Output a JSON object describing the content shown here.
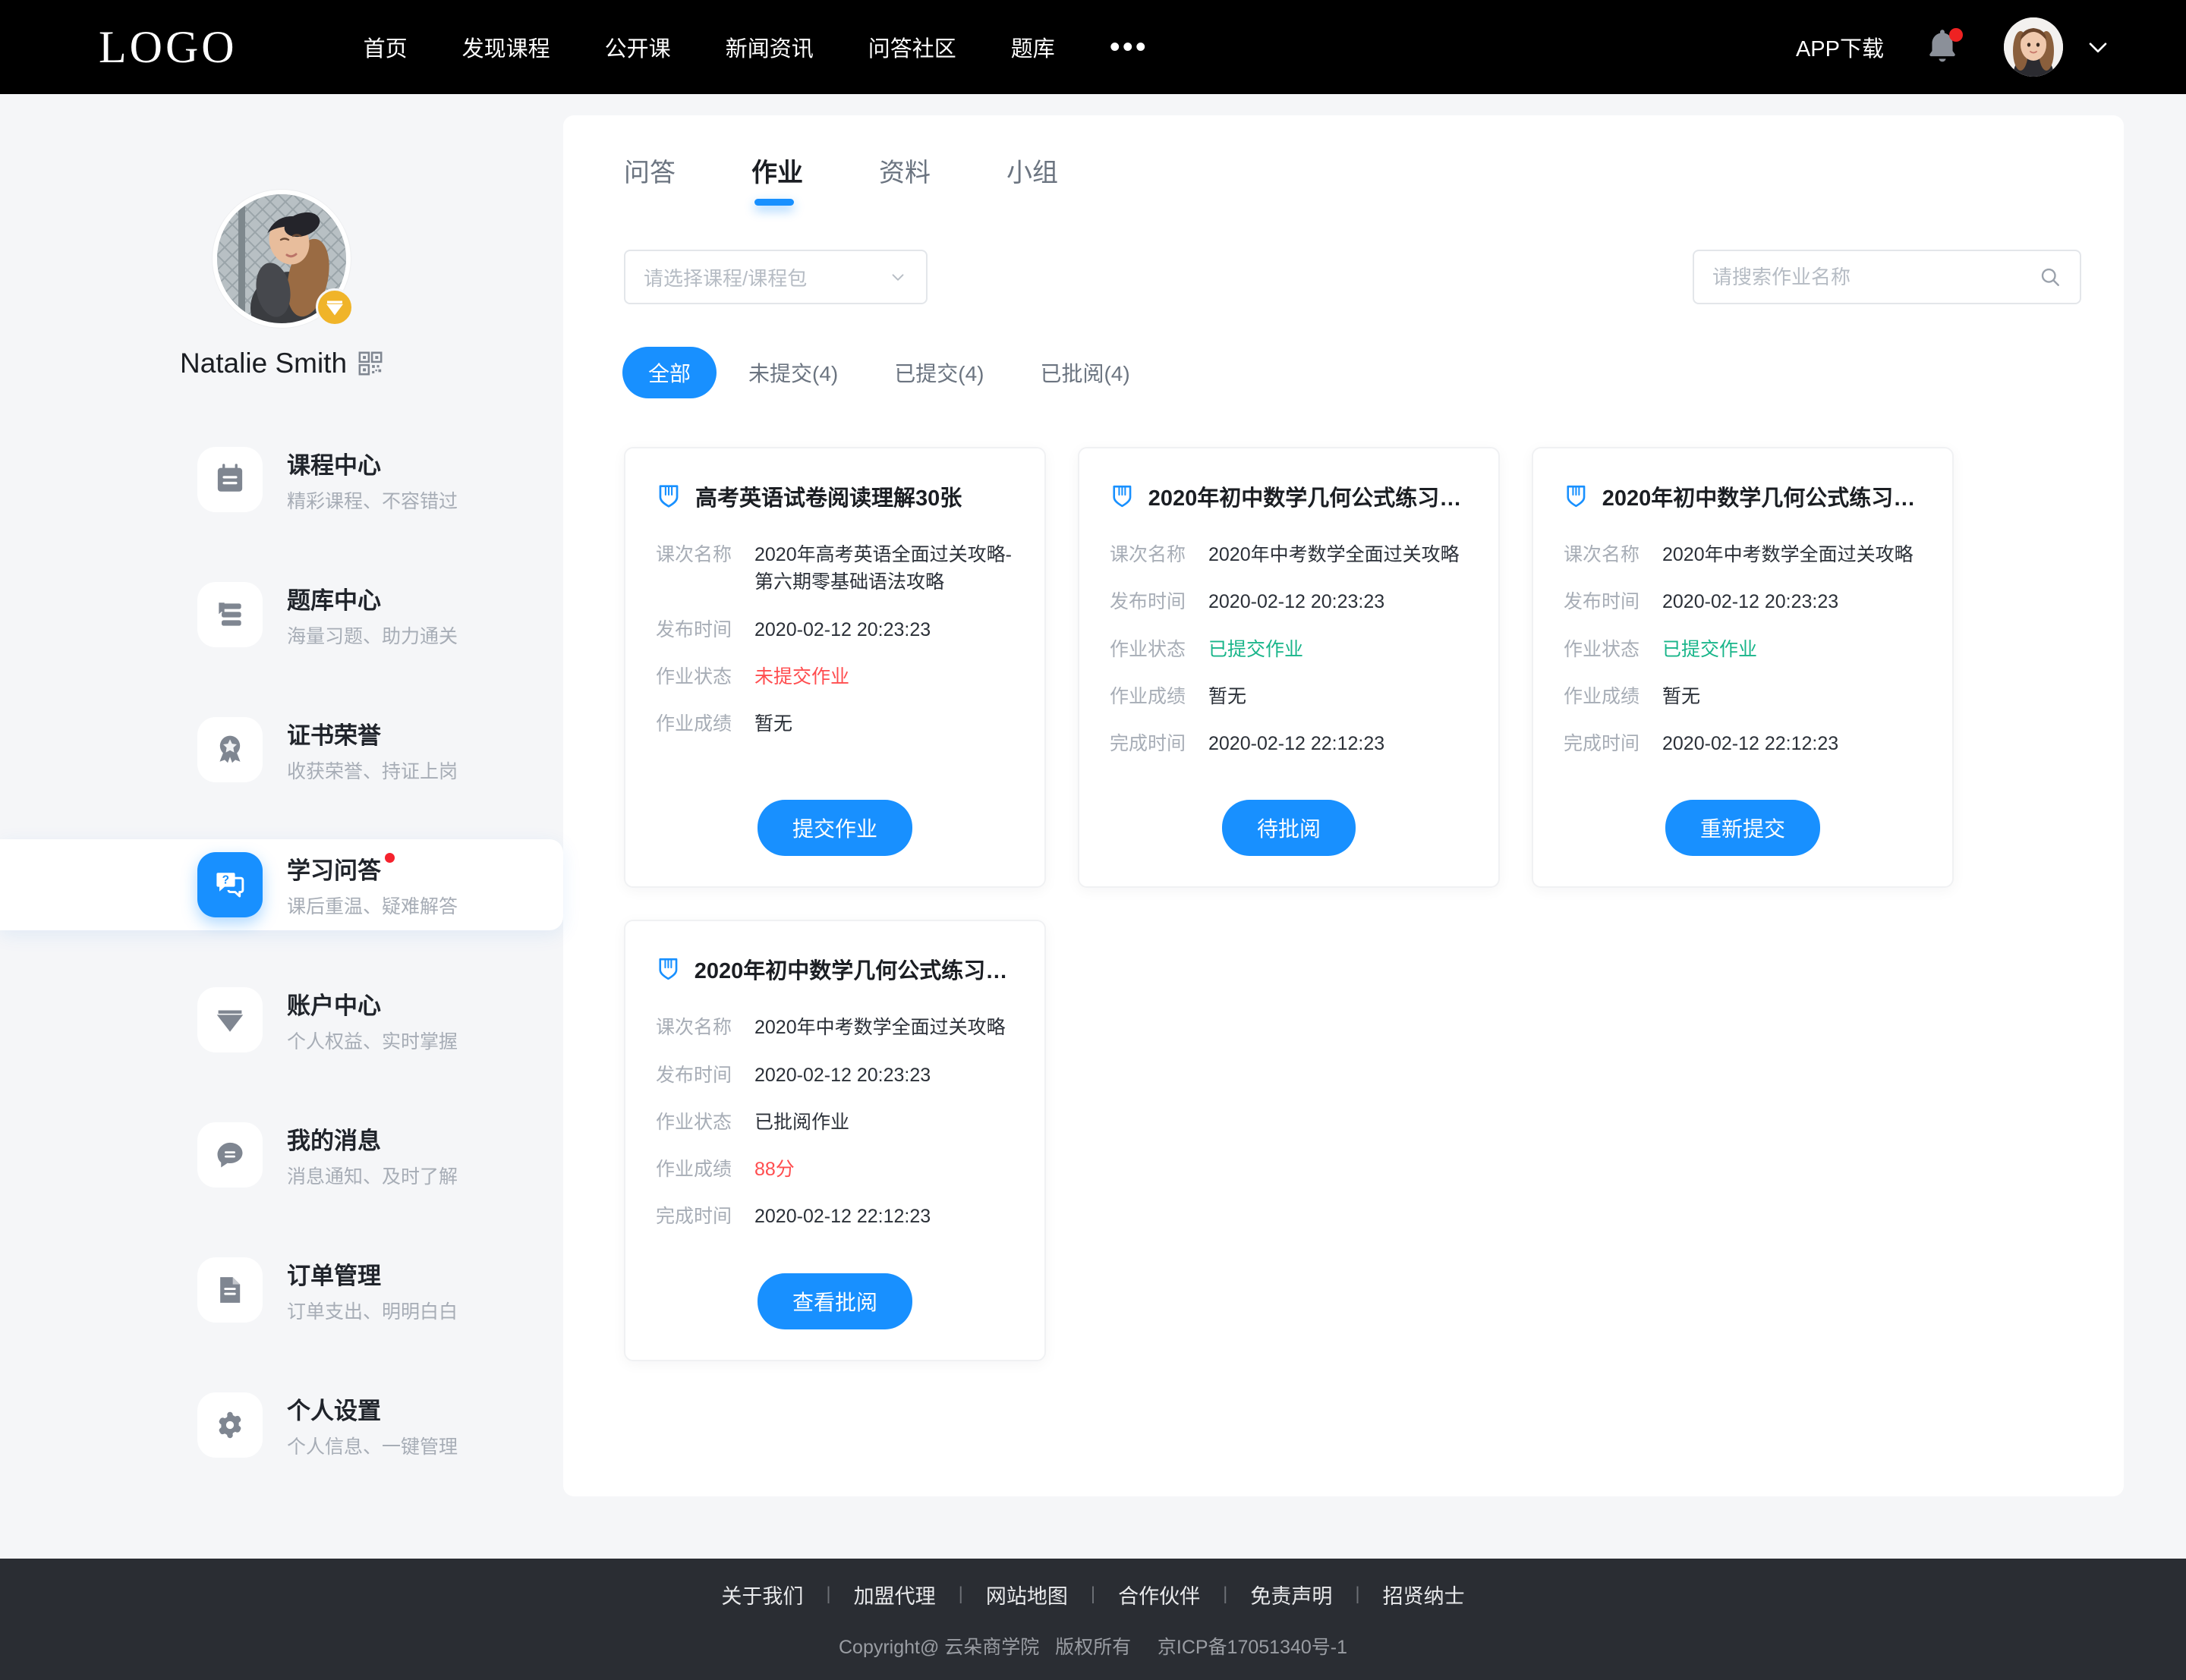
{
  "header": {
    "logo": "LOGO",
    "nav_items": [
      {
        "label": "首页"
      },
      {
        "label": "发现课程"
      },
      {
        "label": "公开课"
      },
      {
        "label": "新闻资讯"
      },
      {
        "label": "问答社区"
      },
      {
        "label": "题库"
      }
    ],
    "more_label": "•••",
    "app_download": "APP下载",
    "bell_icon": "bell-icon",
    "bell_has_badge": true,
    "avatar_icon": "user-avatar",
    "chevron_icon": "chevron-down-icon",
    "background": "#000000"
  },
  "sidebar": {
    "avatar_icon": "profile-avatar",
    "vip_badge_icon": "diamond-icon",
    "vip_badge_color": "#f0b429",
    "username": "Natalie Smith",
    "qr_icon": "qr-code-icon",
    "items": [
      {
        "title": "课程中心",
        "subtitle": "精彩课程、不容错过",
        "icon": "calendar-icon",
        "active": false,
        "dot": false
      },
      {
        "title": "题库中心",
        "subtitle": "海量习题、助力通关",
        "icon": "books-icon",
        "active": false,
        "dot": false
      },
      {
        "title": "证书荣誉",
        "subtitle": "收获荣誉、持证上岗",
        "icon": "medal-icon",
        "active": false,
        "dot": false
      },
      {
        "title": "学习问答",
        "subtitle": "课后重温、疑难解答",
        "icon": "question-chat-icon",
        "active": true,
        "dot": true
      },
      {
        "title": "账户中心",
        "subtitle": "个人权益、实时掌握",
        "icon": "diamond-icon",
        "active": false,
        "dot": false
      },
      {
        "title": "我的消息",
        "subtitle": "消息通知、及时了解",
        "icon": "message-icon",
        "active": false,
        "dot": false
      },
      {
        "title": "订单管理",
        "subtitle": "订单支出、明明白白",
        "icon": "document-icon",
        "active": false,
        "dot": false
      },
      {
        "title": "个人设置",
        "subtitle": "个人信息、一键管理",
        "icon": "gear-icon",
        "active": false,
        "dot": false
      }
    ]
  },
  "main": {
    "tabs": [
      {
        "label": "问答",
        "active": false
      },
      {
        "label": "作业",
        "active": true
      },
      {
        "label": "资料",
        "active": false
      },
      {
        "label": "小组",
        "active": false
      }
    ],
    "course_select": {
      "placeholder": "请选择课程/课程包",
      "value": "",
      "chevron_icon": "chevron-down-icon"
    },
    "search": {
      "placeholder": "请搜索作业名称",
      "value": "",
      "icon": "search-icon"
    },
    "filters": [
      {
        "label": "全部",
        "active": true
      },
      {
        "label": "未提交(4)",
        "active": false
      },
      {
        "label": "已提交(4)",
        "active": false
      },
      {
        "label": "已批阅(4)",
        "active": false
      }
    ],
    "field_labels": {
      "course": "课次名称",
      "publish": "发布时间",
      "status": "作业状态",
      "score": "作业成绩",
      "finish": "完成时间"
    },
    "cards": [
      {
        "icon": "homework-shield-icon",
        "title": "高考英语试卷阅读理解30张",
        "course": "2020年高考英语全面过关攻略-第六期零基础语法攻略",
        "publish": "2020-02-12 20:23:23",
        "status": "未提交作业",
        "status_color": "red",
        "score": "暂无",
        "score_color": "normal",
        "finish": "",
        "button": "提交作业"
      },
      {
        "icon": "homework-shield-icon",
        "title": "2020年初中数学几何公式练习作...",
        "course": "2020年中考数学全面过关攻略",
        "publish": "2020-02-12 20:23:23",
        "status": "已提交作业",
        "status_color": "green",
        "score": "暂无",
        "score_color": "normal",
        "finish": "2020-02-12 22:12:23",
        "button": "待批阅"
      },
      {
        "icon": "homework-shield-icon",
        "title": "2020年初中数学几何公式练习作...",
        "course": "2020年中考数学全面过关攻略",
        "publish": "2020-02-12 20:23:23",
        "status": "已提交作业",
        "status_color": "green",
        "score": "暂无",
        "score_color": "normal",
        "finish": "2020-02-12 22:12:23",
        "button": "重新提交"
      },
      {
        "icon": "homework-shield-icon",
        "title": "2020年初中数学几何公式练习作...",
        "course": "2020年中考数学全面过关攻略",
        "publish": "2020-02-12 20:23:23",
        "status": "已批阅作业",
        "status_color": "normal",
        "score": "88分",
        "score_color": "red",
        "finish": "2020-02-12 22:12:23",
        "button": "查看批阅"
      }
    ]
  },
  "footer": {
    "links": [
      {
        "label": "关于我们"
      },
      {
        "label": "加盟代理"
      },
      {
        "label": "网站地图"
      },
      {
        "label": "合作伙伴"
      },
      {
        "label": "免责声明"
      },
      {
        "label": "招贤纳士"
      }
    ],
    "separator": "|",
    "copyright": "Copyright@ 云朵商学院   版权所有     京ICP备17051340号-1",
    "background": "#2a2d33"
  },
  "colors": {
    "accent": "#1890ff",
    "danger": "#ff4d4f",
    "success": "#19b58a",
    "vip": "#f0b429",
    "page_bg": "#f5f6f8"
  }
}
